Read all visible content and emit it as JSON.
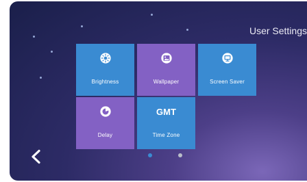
{
  "header": {
    "title": "User Settings"
  },
  "tiles": [
    {
      "label": "Brightness",
      "icon": "brightness-icon",
      "color": "#3a8bd2"
    },
    {
      "label": "Wallpaper",
      "icon": "wallpaper-icon",
      "color": "#8361c4"
    },
    {
      "label": "Screen Saver",
      "icon": "screen-saver-icon",
      "color": "#3a8bd2"
    },
    {
      "label": "Delay",
      "icon": "delay-icon",
      "color": "#8361c4"
    },
    {
      "label": "Time Zone",
      "icon": "time-zone-icon",
      "icon_text": "GMT",
      "color": "#3a8bd2"
    }
  ],
  "pagination": {
    "page_count": 2,
    "active_page": 1,
    "active_color": "#3a8bd2",
    "inactive_color": "#b9bdc9"
  },
  "nav": {
    "back_icon": "back-chevron-icon"
  }
}
